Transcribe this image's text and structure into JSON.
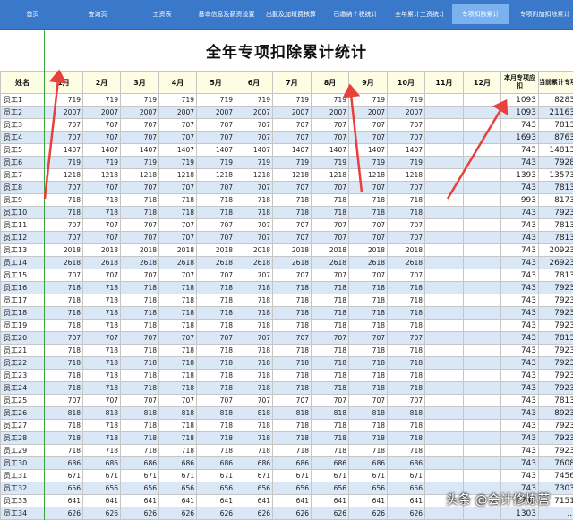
{
  "nav": [
    "首页",
    "查询页",
    "工资表",
    "基本信息及薪资设置",
    "出勤及加班费核算",
    "已缴纳个税统计",
    "全年累计工资统计",
    "专项扣除累计",
    "专项附加扣除累计"
  ],
  "active_tab": 7,
  "title": "全年专项扣除累计统计",
  "headers": [
    "姓名",
    "1月",
    "2月",
    "3月",
    "4月",
    "5月",
    "6月",
    "7月",
    "8月",
    "9月",
    "10月",
    "11月",
    "12月",
    "本月专项应扣",
    "当前累计专项"
  ],
  "rows": [
    [
      "员工1",
      "719",
      "719",
      "719",
      "719",
      "719",
      "719",
      "719",
      "719",
      "719",
      "719",
      "",
      "",
      "1093",
      "8283"
    ],
    [
      "员工2",
      "2007",
      "2007",
      "2007",
      "2007",
      "2007",
      "2007",
      "2007",
      "2007",
      "2007",
      "2007",
      "",
      "",
      "1093",
      "21163"
    ],
    [
      "员工3",
      "707",
      "707",
      "707",
      "707",
      "707",
      "707",
      "707",
      "707",
      "707",
      "707",
      "",
      "",
      "743",
      "7813"
    ],
    [
      "员工4",
      "707",
      "707",
      "707",
      "707",
      "707",
      "707",
      "707",
      "707",
      "707",
      "707",
      "",
      "",
      "1693",
      "8763"
    ],
    [
      "员工5",
      "1407",
      "1407",
      "1407",
      "1407",
      "1407",
      "1407",
      "1407",
      "1407",
      "1407",
      "1407",
      "",
      "",
      "743",
      "14813"
    ],
    [
      "员工6",
      "719",
      "719",
      "719",
      "719",
      "719",
      "719",
      "719",
      "719",
      "719",
      "719",
      "",
      "",
      "743",
      "7928"
    ],
    [
      "员工7",
      "1218",
      "1218",
      "1218",
      "1218",
      "1218",
      "1218",
      "1218",
      "1218",
      "1218",
      "1218",
      "",
      "",
      "1393",
      "13573"
    ],
    [
      "员工8",
      "707",
      "707",
      "707",
      "707",
      "707",
      "707",
      "707",
      "707",
      "707",
      "707",
      "",
      "",
      "743",
      "7813"
    ],
    [
      "员工9",
      "718",
      "718",
      "718",
      "718",
      "718",
      "718",
      "718",
      "718",
      "718",
      "718",
      "",
      "",
      "993",
      "8173"
    ],
    [
      "员工10",
      "718",
      "718",
      "718",
      "718",
      "718",
      "718",
      "718",
      "718",
      "718",
      "718",
      "",
      "",
      "743",
      "7923"
    ],
    [
      "员工11",
      "707",
      "707",
      "707",
      "707",
      "707",
      "707",
      "707",
      "707",
      "707",
      "707",
      "",
      "",
      "743",
      "7813"
    ],
    [
      "员工12",
      "707",
      "707",
      "707",
      "707",
      "707",
      "707",
      "707",
      "707",
      "707",
      "707",
      "",
      "",
      "743",
      "7813"
    ],
    [
      "员工13",
      "2018",
      "2018",
      "2018",
      "2018",
      "2018",
      "2018",
      "2018",
      "2018",
      "2018",
      "2018",
      "",
      "",
      "743",
      "20923"
    ],
    [
      "员工14",
      "2618",
      "2618",
      "2618",
      "2618",
      "2618",
      "2618",
      "2618",
      "2618",
      "2618",
      "2618",
      "",
      "",
      "743",
      "26923"
    ],
    [
      "员工15",
      "707",
      "707",
      "707",
      "707",
      "707",
      "707",
      "707",
      "707",
      "707",
      "707",
      "",
      "",
      "743",
      "7813"
    ],
    [
      "员工16",
      "718",
      "718",
      "718",
      "718",
      "718",
      "718",
      "718",
      "718",
      "718",
      "718",
      "",
      "",
      "743",
      "7923"
    ],
    [
      "员工17",
      "718",
      "718",
      "718",
      "718",
      "718",
      "718",
      "718",
      "718",
      "718",
      "718",
      "",
      "",
      "743",
      "7923"
    ],
    [
      "员工18",
      "718",
      "718",
      "718",
      "718",
      "718",
      "718",
      "718",
      "718",
      "718",
      "718",
      "",
      "",
      "743",
      "7923"
    ],
    [
      "员工19",
      "718",
      "718",
      "718",
      "718",
      "718",
      "718",
      "718",
      "718",
      "718",
      "718",
      "",
      "",
      "743",
      "7923"
    ],
    [
      "员工20",
      "707",
      "707",
      "707",
      "707",
      "707",
      "707",
      "707",
      "707",
      "707",
      "707",
      "",
      "",
      "743",
      "7813"
    ],
    [
      "员工21",
      "718",
      "718",
      "718",
      "718",
      "718",
      "718",
      "718",
      "718",
      "718",
      "718",
      "",
      "",
      "743",
      "7923"
    ],
    [
      "员工22",
      "718",
      "718",
      "718",
      "718",
      "718",
      "718",
      "718",
      "718",
      "718",
      "718",
      "",
      "",
      "743",
      "7923"
    ],
    [
      "员工23",
      "718",
      "718",
      "718",
      "718",
      "718",
      "718",
      "718",
      "718",
      "718",
      "718",
      "",
      "",
      "743",
      "7923"
    ],
    [
      "员工24",
      "718",
      "718",
      "718",
      "718",
      "718",
      "718",
      "718",
      "718",
      "718",
      "718",
      "",
      "",
      "743",
      "7923"
    ],
    [
      "员工25",
      "707",
      "707",
      "707",
      "707",
      "707",
      "707",
      "707",
      "707",
      "707",
      "707",
      "",
      "",
      "743",
      "7813"
    ],
    [
      "员工26",
      "818",
      "818",
      "818",
      "818",
      "818",
      "818",
      "818",
      "818",
      "818",
      "818",
      "",
      "",
      "743",
      "8923"
    ],
    [
      "员工27",
      "718",
      "718",
      "718",
      "718",
      "718",
      "718",
      "718",
      "718",
      "718",
      "718",
      "",
      "",
      "743",
      "7923"
    ],
    [
      "员工28",
      "718",
      "718",
      "718",
      "718",
      "718",
      "718",
      "718",
      "718",
      "718",
      "718",
      "",
      "",
      "743",
      "7923"
    ],
    [
      "员工29",
      "718",
      "718",
      "718",
      "718",
      "718",
      "718",
      "718",
      "718",
      "718",
      "718",
      "",
      "",
      "743",
      "7923"
    ],
    [
      "员工30",
      "686",
      "686",
      "686",
      "686",
      "686",
      "686",
      "686",
      "686",
      "686",
      "686",
      "",
      "",
      "743",
      "7608"
    ],
    [
      "员工31",
      "671",
      "671",
      "671",
      "671",
      "671",
      "671",
      "671",
      "671",
      "671",
      "671",
      "",
      "",
      "743",
      "7456"
    ],
    [
      "员工32",
      "656",
      "656",
      "656",
      "656",
      "656",
      "656",
      "656",
      "656",
      "656",
      "656",
      "",
      "",
      "743",
      "7303"
    ],
    [
      "员工33",
      "641",
      "641",
      "641",
      "641",
      "641",
      "641",
      "641",
      "641",
      "641",
      "641",
      "",
      "",
      "743",
      "7151"
    ],
    [
      "员工34",
      "626",
      "626",
      "626",
      "626",
      "626",
      "626",
      "626",
      "626",
      "626",
      "626",
      "",
      "",
      "1303",
      "..."
    ]
  ],
  "watermark": "头条 @会计修炼营",
  "colors": {
    "nav_bg": "#3a79c9",
    "nav_active": "#7cb1ef",
    "header_bg": "#fdfde3",
    "row_band": "#d9e7f6",
    "arrow": "#e8403a",
    "guide_line": "#3aa53a"
  }
}
